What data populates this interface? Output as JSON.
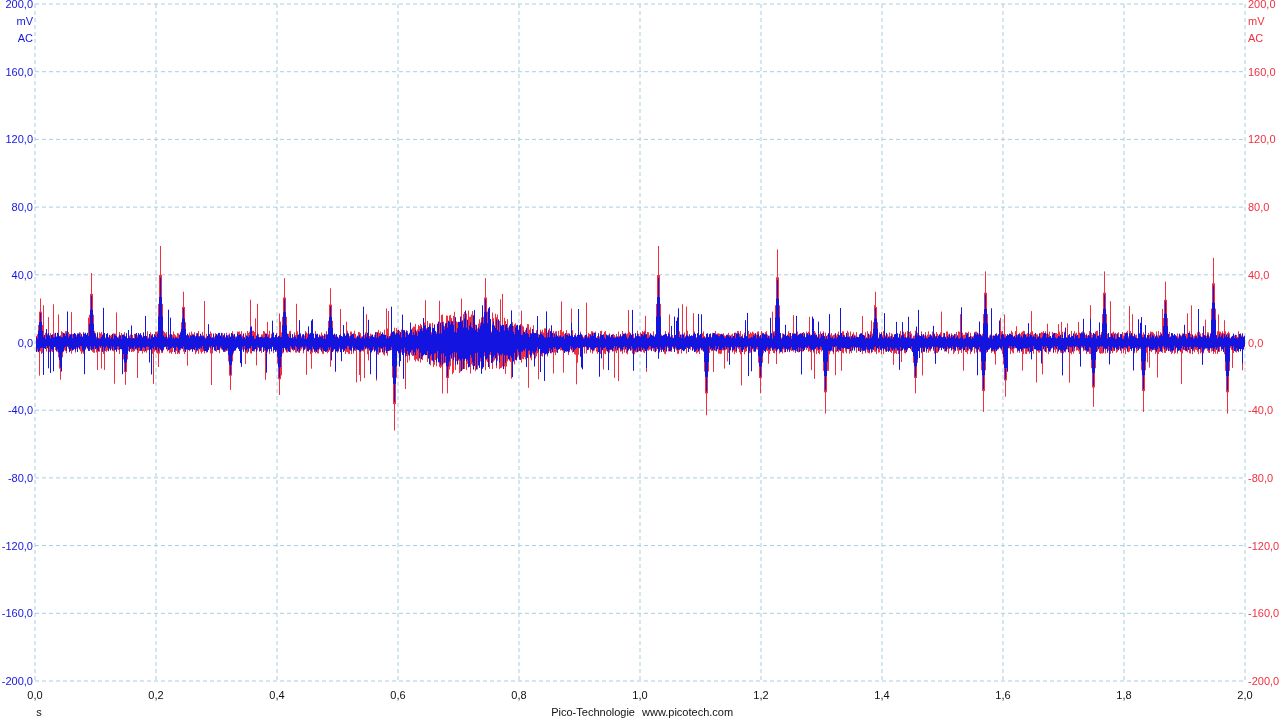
{
  "y_axes": [
    {
      "kind": "left",
      "color": "#1414e0",
      "ticks": [
        "200,0",
        "160,0",
        "120,0",
        "80,0",
        "40,0",
        "0,0",
        "-40,0",
        "-80,0",
        "-120,0",
        "-160,0",
        "-200,0"
      ],
      "unit": "mV",
      "coupling": "AC"
    },
    {
      "kind": "right",
      "color": "#f03040",
      "ticks": [
        "200,0",
        "160,0",
        "120,0",
        "80,0",
        "40,0",
        "0,0",
        "-40,0",
        "-80,0",
        "-120,0",
        "-160,0",
        "-200,0"
      ],
      "unit": "mV",
      "coupling": "AC"
    }
  ],
  "x_axis": {
    "ticks": [
      "0,0",
      "0,2",
      "0,4",
      "0,6",
      "0,8",
      "1,0",
      "1,2",
      "1,4",
      "1,6",
      "1,8",
      "2,0"
    ],
    "unit": "s"
  },
  "footer": {
    "company": "Pico-Technologie",
    "website": "www.picotech.com"
  }
}
